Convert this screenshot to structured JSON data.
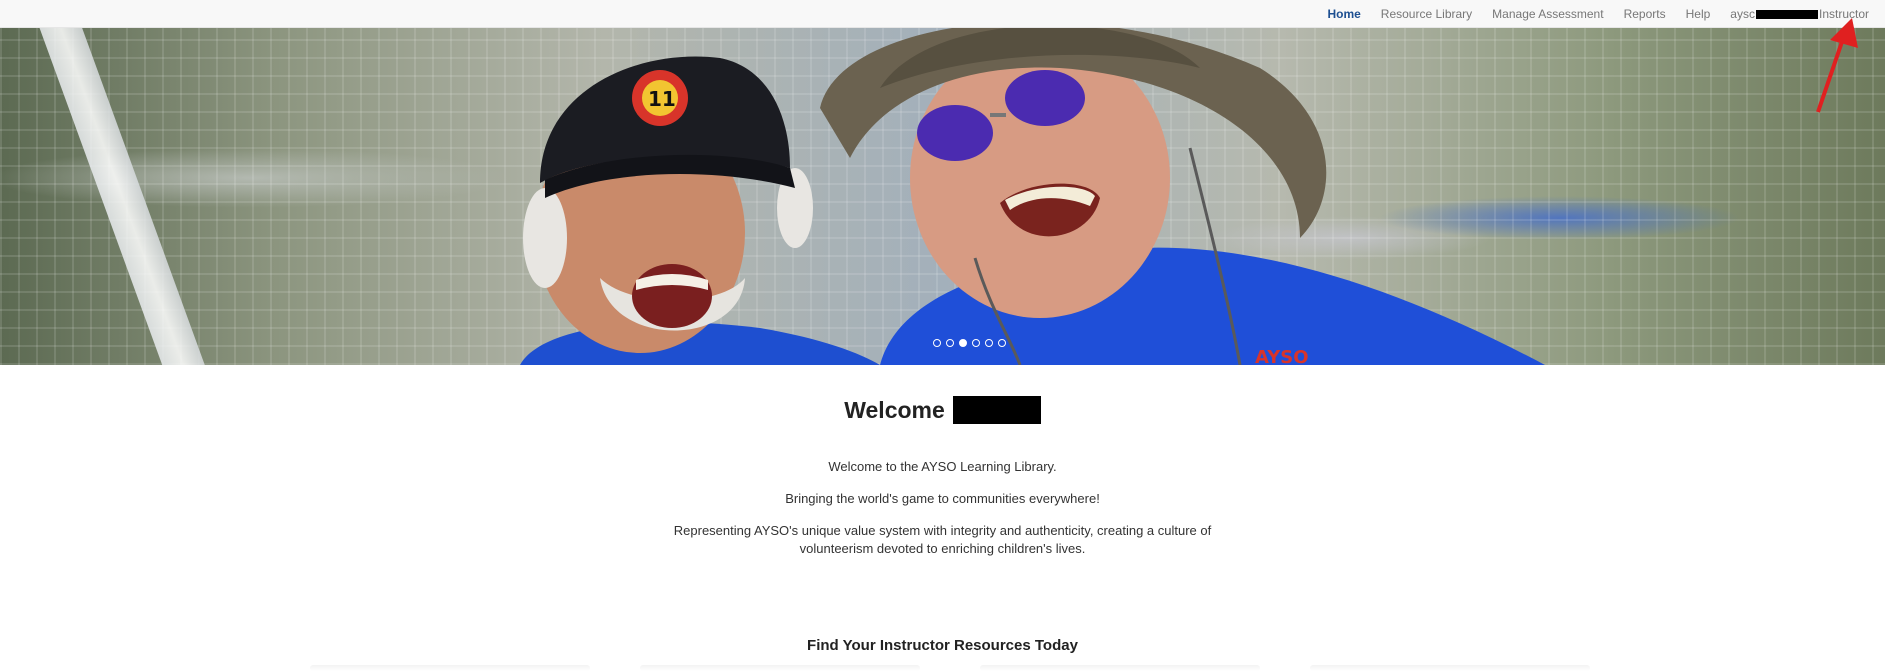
{
  "nav": {
    "items": [
      {
        "label": "Home",
        "active": true
      },
      {
        "label": "Resource Library",
        "active": false
      },
      {
        "label": "Manage Assessment",
        "active": false
      },
      {
        "label": "Reports",
        "active": false
      },
      {
        "label": "Help",
        "active": false
      }
    ],
    "user": {
      "prefix": "aysc",
      "suffix": "Instructor"
    }
  },
  "hero": {
    "slide_count": 6,
    "active_slide": 3
  },
  "welcome": {
    "title": "Welcome"
  },
  "intro": {
    "line1": "Welcome to the AYSO Learning Library.",
    "line2": "Bringing the world's game to communities everywhere!",
    "line3": "Representing AYSO's unique value system with integrity and authenticity, creating a culture of volunteerism devoted to enriching children's lives."
  },
  "resources": {
    "title": "Find Your Instructor Resources Today"
  },
  "colors": {
    "nav_active": "#1d4f91",
    "annotation_arrow": "#e02020"
  }
}
